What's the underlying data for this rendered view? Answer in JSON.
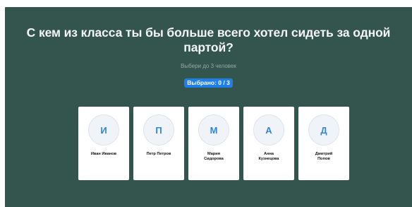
{
  "survey": {
    "question": "С кем из класса ты бы больше всего хотел сидеть за одной партой?",
    "hint": "Выбери до 3 человек",
    "counter": "Выбрано: 0 / 3"
  },
  "classmates": [
    {
      "initial": "И",
      "name": "Иван Иванов"
    },
    {
      "initial": "П",
      "name": "Петр Петров"
    },
    {
      "initial": "М",
      "name": "Мария\nСидорова"
    },
    {
      "initial": "А",
      "name": "Анна\nКузнецова"
    },
    {
      "initial": "Д",
      "name": "Дмитрий\nПопов"
    }
  ],
  "colors": {
    "panel_background": "#33554d",
    "accent": "#1f7fe6",
    "avatar_letter": "#2f86dd"
  }
}
